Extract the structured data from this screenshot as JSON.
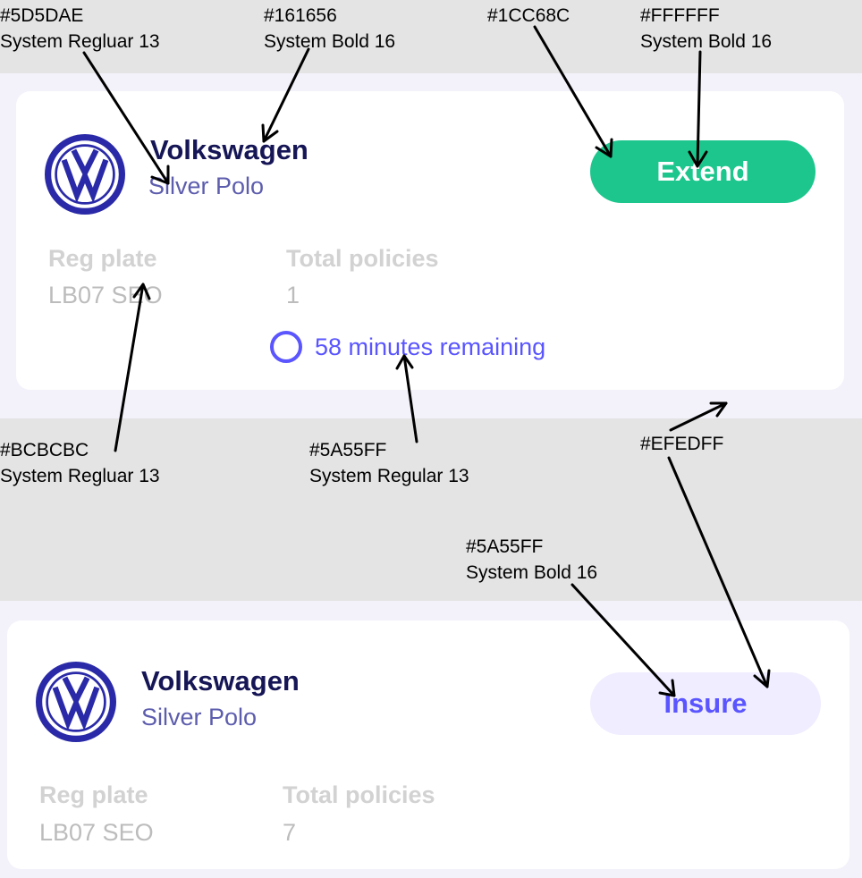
{
  "cards": [
    {
      "brand": "Volkswagen",
      "model": "Silver Polo",
      "reg_label": "Reg plate",
      "reg_value": "LB07 SEO",
      "policies_label": "Total policies",
      "policies_value": "1",
      "action_label": "Extend",
      "timer_text": "58 minutes remaining"
    },
    {
      "brand": "Volkswagen",
      "model": "Silver Polo",
      "reg_label": "Reg plate",
      "reg_value": "LB07 SEO",
      "policies_label": "Total policies",
      "policies_value": "7",
      "action_label": "Insure"
    }
  ],
  "annotations": [
    {
      "color": "#5D5DAE",
      "font": "System Regluar 13"
    },
    {
      "color": "#161656",
      "font": "System Bold 16"
    },
    {
      "color": "#1CC68C",
      "font": ""
    },
    {
      "color": "#FFFFFF",
      "font": "System Bold 16"
    },
    {
      "color": "#BCBCBC",
      "font": "System Regluar 13"
    },
    {
      "color": "#5A55FF",
      "font": "System Regular 13"
    },
    {
      "color": "#EFEDFF",
      "font": ""
    },
    {
      "color": "#5A55FF",
      "font": "System Bold 16"
    }
  ],
  "colors": {
    "title": "#161656",
    "subtitle": "#5D5DAE",
    "muted": "#BCBCBC",
    "accent": "#5A55FF",
    "extend_bg": "#1CC68C",
    "insure_bg": "#EFEDFF",
    "button_text": "#FFFFFF"
  },
  "icons": [
    "volkswagen-logo-icon",
    "timer-ring-icon"
  ]
}
